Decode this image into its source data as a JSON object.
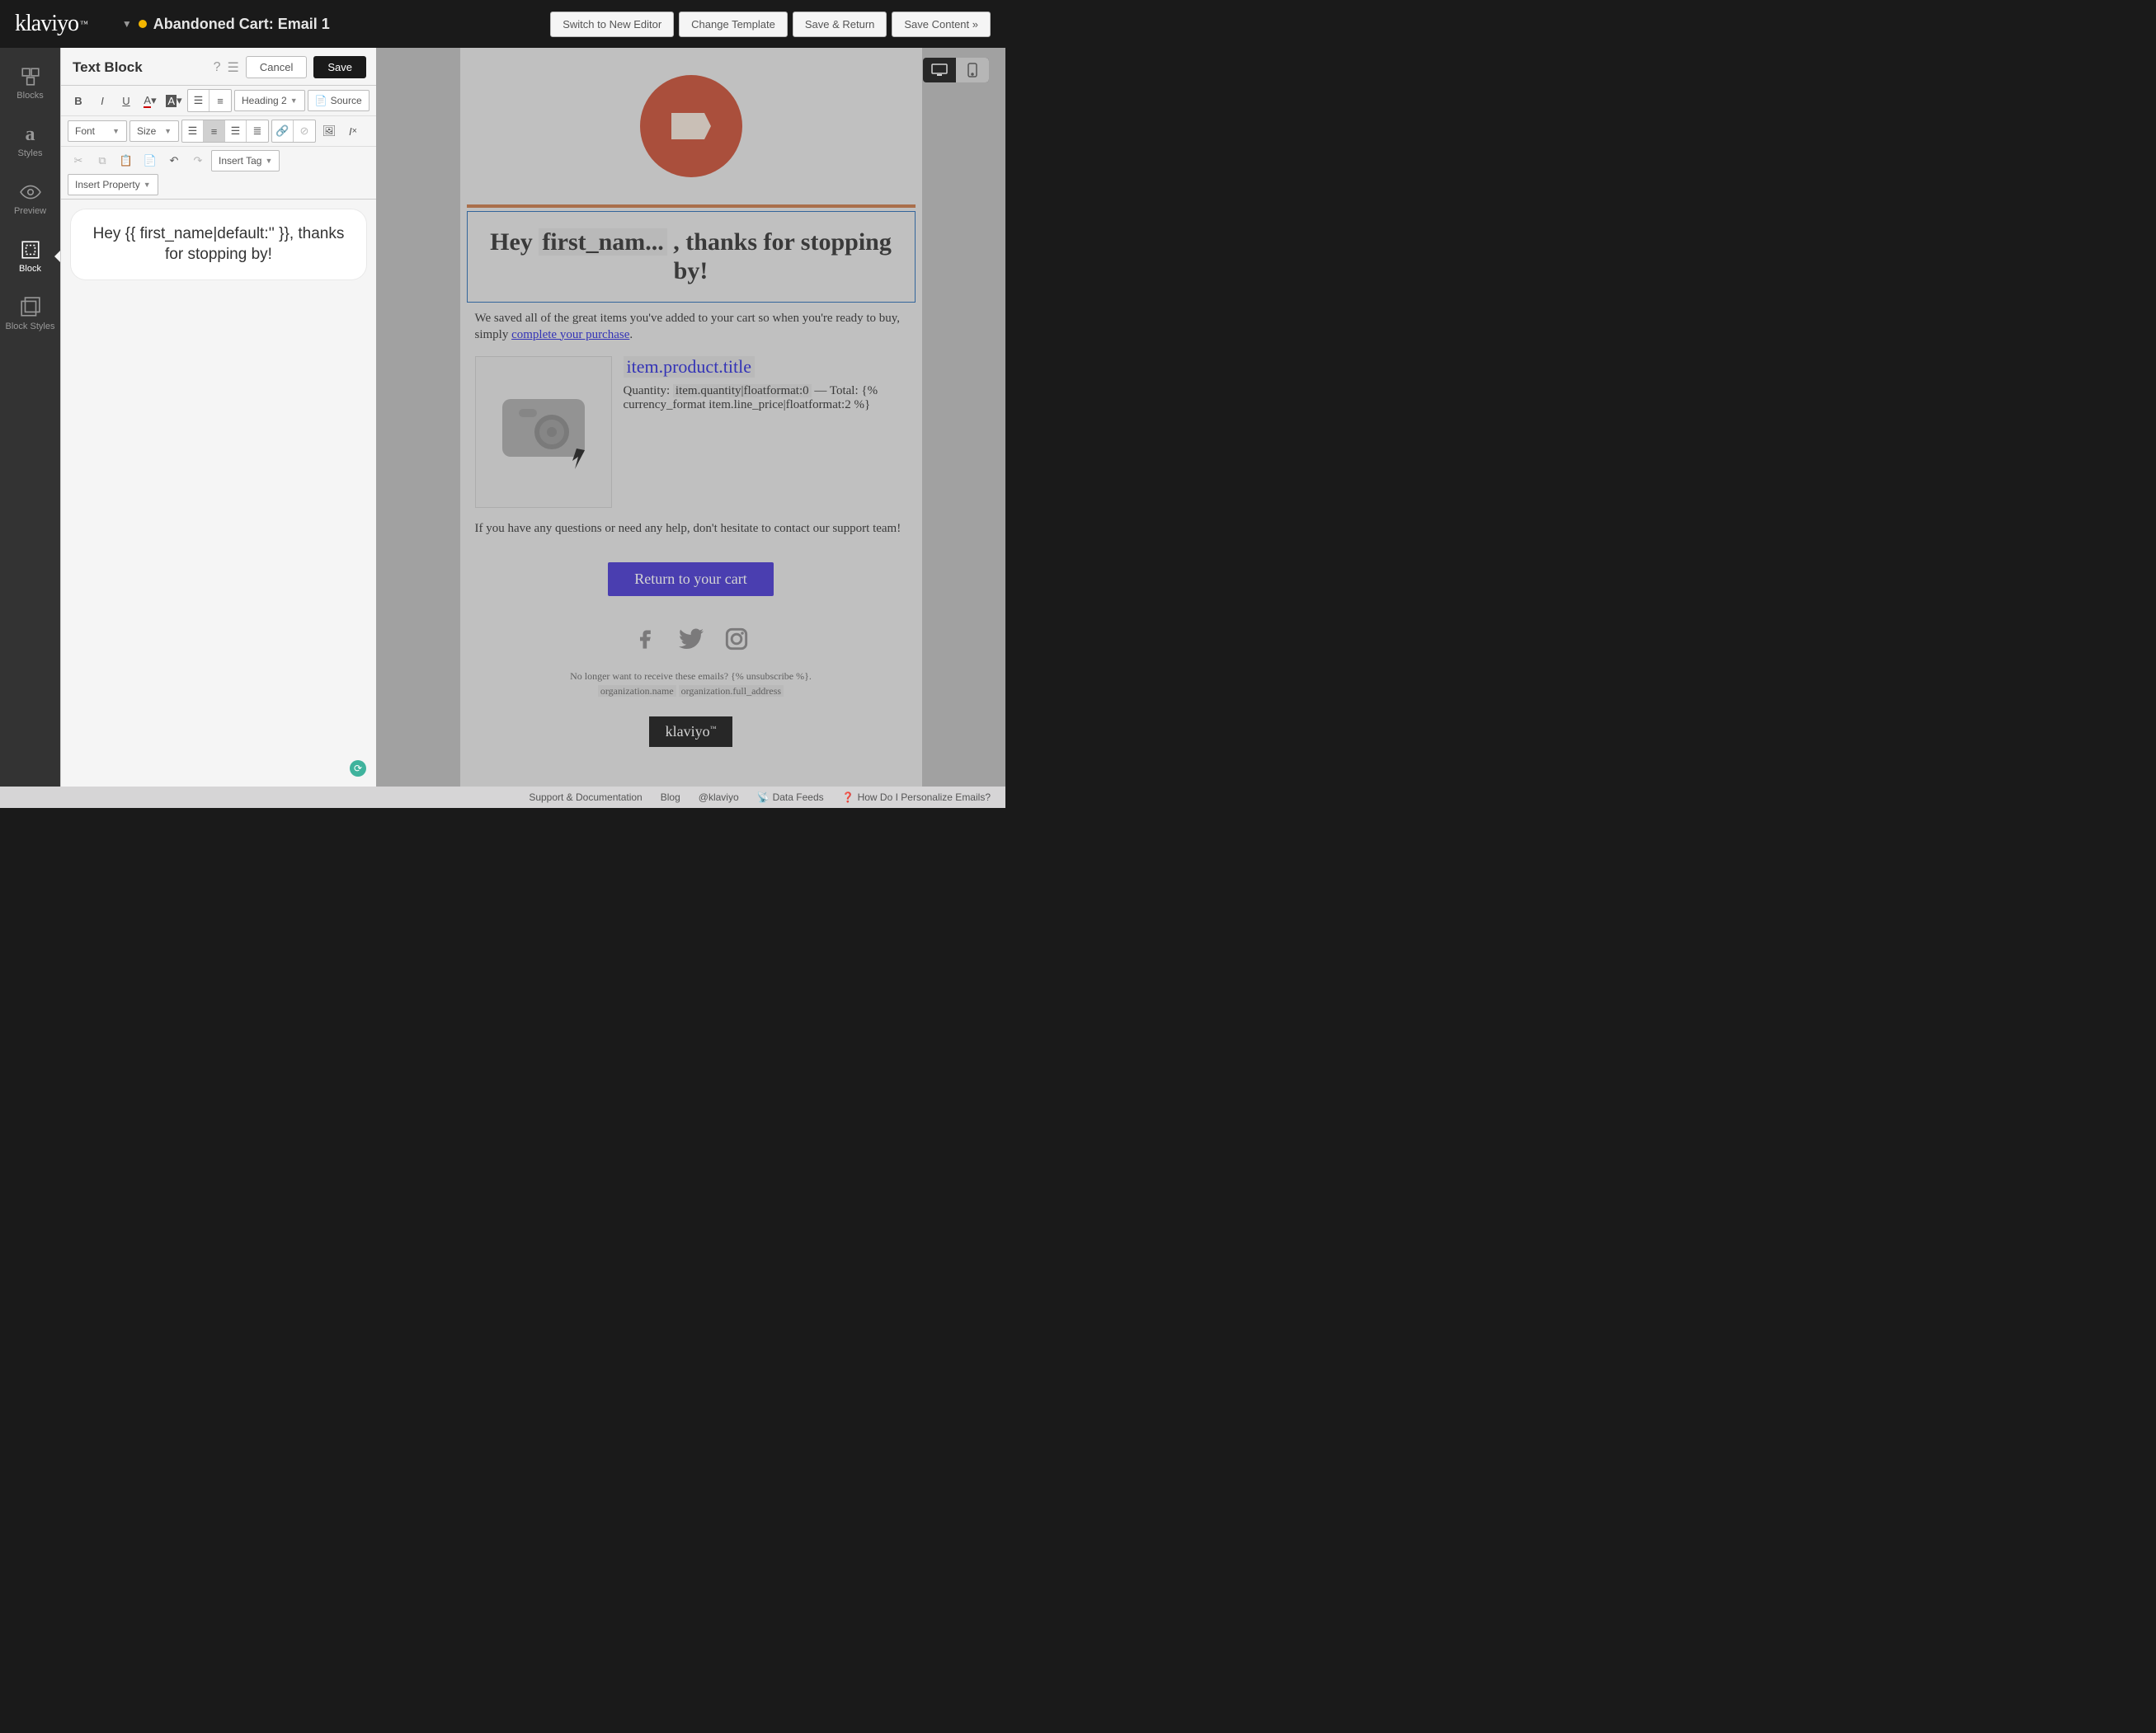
{
  "app": {
    "logo": "klaviyo",
    "title": "Abandoned Cart: Email 1"
  },
  "header_buttons": [
    "Switch to New Editor",
    "Change Template",
    "Save & Return",
    "Save Content »"
  ],
  "leftnav": [
    {
      "label": "Blocks",
      "icon": "blocks"
    },
    {
      "label": "Styles",
      "icon": "styles"
    },
    {
      "label": "Preview",
      "icon": "preview"
    },
    {
      "label": "Block",
      "icon": "block",
      "sel": true
    },
    {
      "label": "Block Styles",
      "icon": "block-styles"
    }
  ],
  "editor": {
    "title": "Text Block",
    "cancel": "Cancel",
    "save": "Save",
    "heading_dd": "Heading 2",
    "source": "Source",
    "font_dd": "Font",
    "size_dd": "Size",
    "insert_tag": "Insert Tag",
    "insert_prop": "Insert Property",
    "text": "Hey {{ first_name|default:'' }}, thanks for stopping by!"
  },
  "email": {
    "headline_pre": "Hey ",
    "headline_tag": "first_nam...",
    "headline_post": " , thanks for stopping by!",
    "intro_pre": "We saved all of the great items you've added to your cart so when you're ready to buy, simply ",
    "intro_link": "complete your purchase",
    "intro_post": ".",
    "product_title": "item.product.title",
    "qty_label": "Quantity: ",
    "qty_tag": "item.quantity|floatformat:0",
    "total_label": " — Total: ",
    "total_tag": "{% currency_format item.line_price|floatformat:2 %}",
    "support": "If you have any questions or need any help, don't hesitate to contact our support team!",
    "cta": "Return to your cart",
    "unsub_pre": "No longer want to receive these emails? ",
    "unsub_tag": "{% unsubscribe %}",
    "unsub_post": ".",
    "org_name": "organization.name",
    "org_addr": "organization.full_address",
    "footer_logo": "klaviyo"
  },
  "bottombar": [
    "Support & Documentation",
    "Blog",
    "@klaviyo",
    "Data Feeds",
    "How Do I Personalize Emails?"
  ]
}
